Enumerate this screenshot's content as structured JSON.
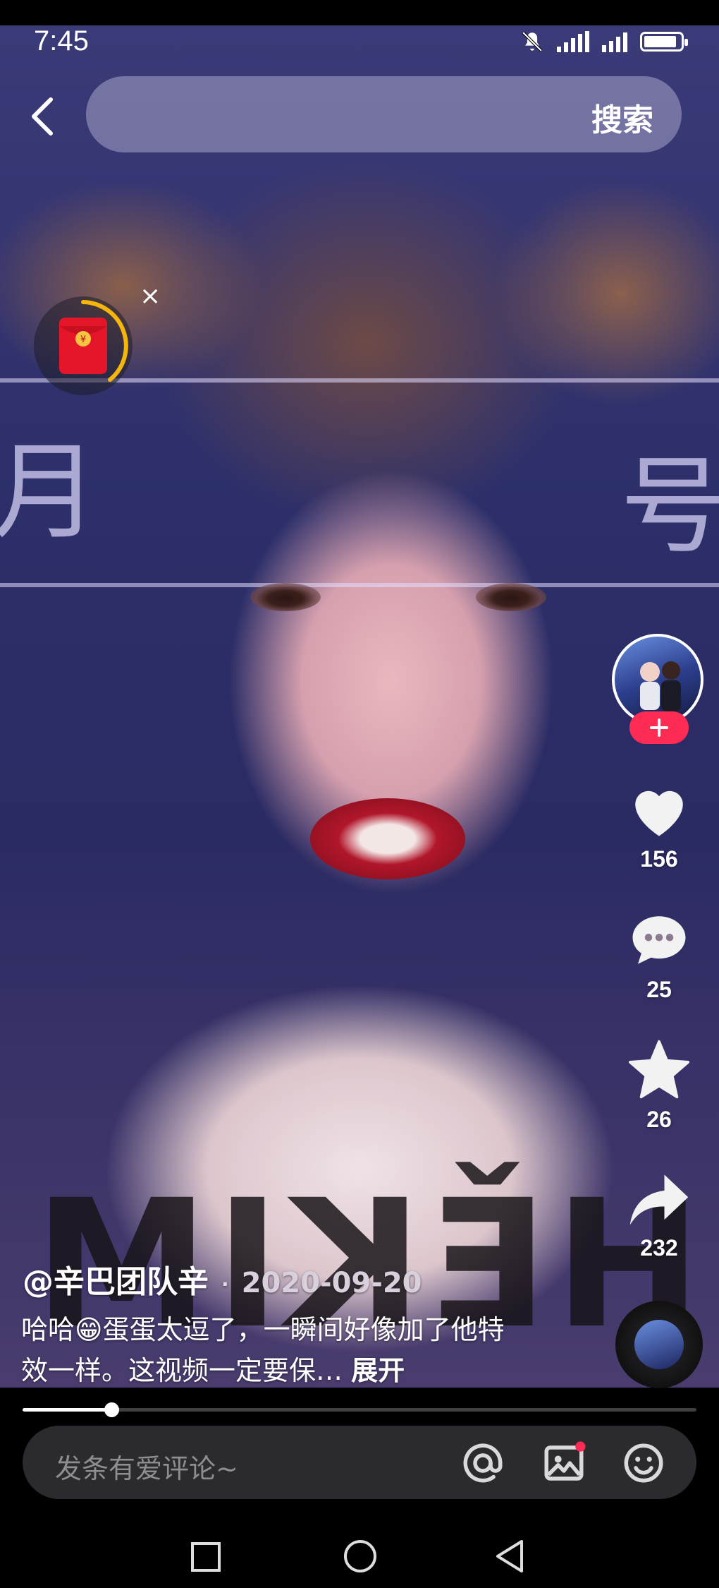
{
  "status_bar": {
    "time": "7:45"
  },
  "header": {
    "search_label": "搜索"
  },
  "video": {
    "progress_fraction": 0.132
  },
  "actions": {
    "like_count": "156",
    "comment_count": "25",
    "favorite_count": "26",
    "share_count": "232"
  },
  "post": {
    "author": "@辛巴团队辛",
    "date": "2020-09-20",
    "caption": "哈哈😁蛋蛋太逗了，一瞬间好像加了他特效一样。这视频一定要保… ",
    "expand_label": "展开"
  },
  "comment_bar": {
    "placeholder": "发条有爱评论~"
  },
  "colors": {
    "accent": "#fe2c55",
    "timer_ring": "#f5b60c",
    "red_packet": "#e5162a"
  }
}
